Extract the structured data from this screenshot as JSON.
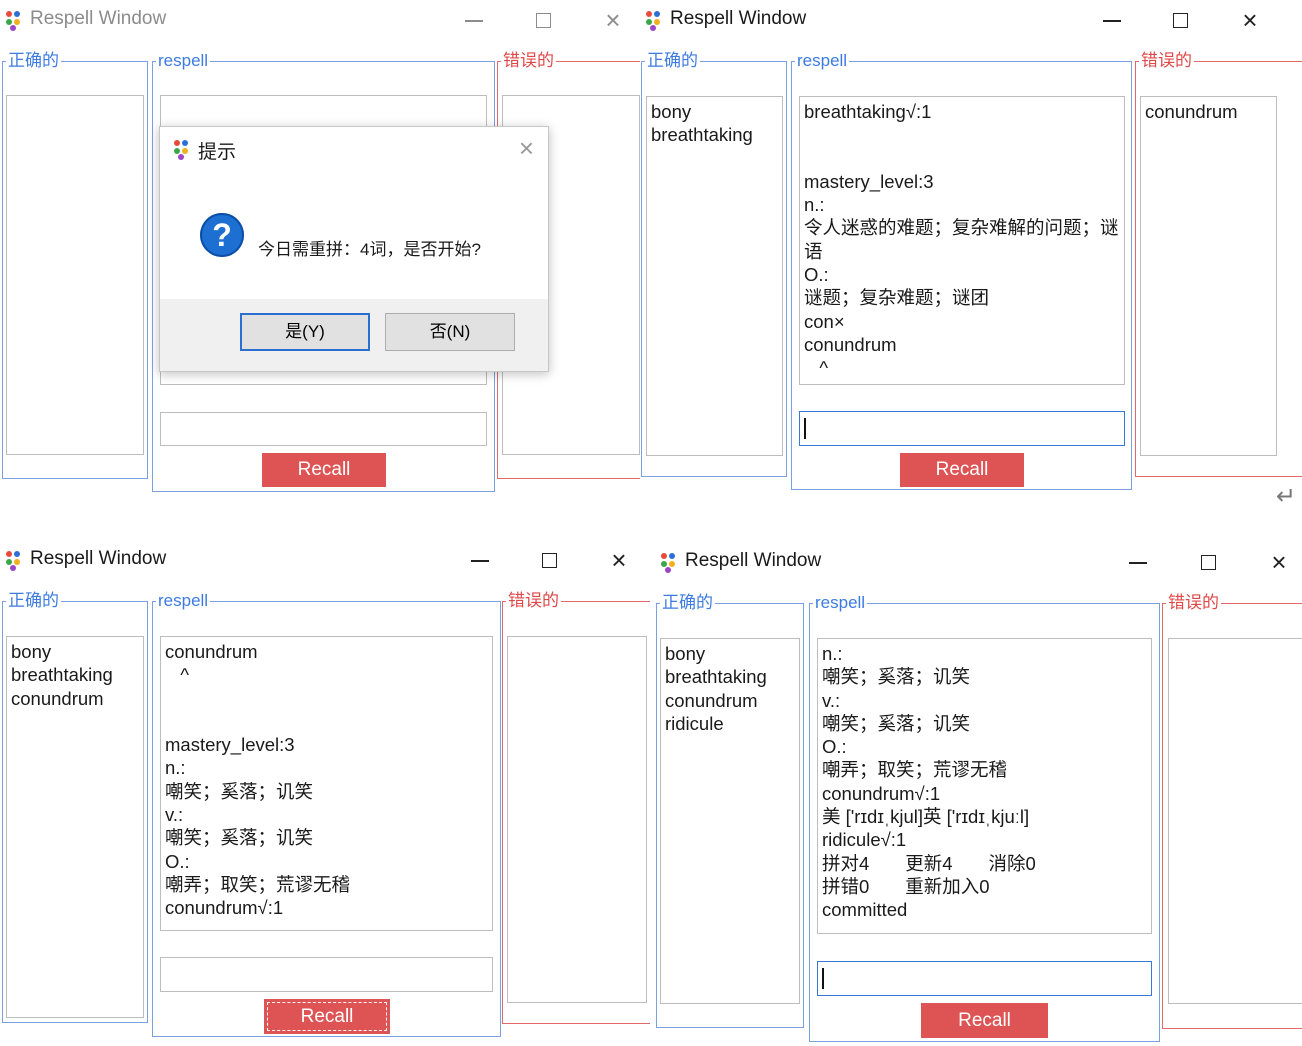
{
  "app_title": "Respell Window",
  "group_labels": {
    "correct": "正确的",
    "respell": "respell",
    "wrong": "错误的"
  },
  "recall_label": "Recall",
  "window_controls": {
    "minimize": "minimize-icon",
    "maximize": "maximize-icon",
    "close": "close-icon"
  },
  "windows": [
    {
      "id": "top-left",
      "active": false,
      "correct_list": "",
      "respell_text": "",
      "wrong_list": "",
      "dialog": {
        "title": "提示",
        "message": "今日需重拼：4词，是否开始?",
        "yes_label": "是(Y)",
        "no_label": "否(N)",
        "icon": "question-icon"
      }
    },
    {
      "id": "top-right",
      "active": true,
      "correct_list": "bony\nbreathtaking",
      "respell_text": "breathtaking√:1\n\n\nmastery_level:3\nn.:\n令人迷惑的难题；复杂难解的问题；谜\n语\nO.:\n谜题；复杂难题；谜团\ncon×\nconundrum\n   ^",
      "wrong_list": "conundrum"
    },
    {
      "id": "bottom-left",
      "active": true,
      "correct_list": "bony\nbreathtaking\nconundrum",
      "respell_text": "conundrum\n   ^\n\n\nmastery_level:3\nn.:\n嘲笑；奚落；讥笑\nv.:\n嘲笑；奚落；讥笑\nO.:\n嘲弄；取笑；荒谬无稽\nconundrum√:1",
      "wrong_list": ""
    },
    {
      "id": "bottom-right",
      "active": true,
      "correct_list": "bony\nbreathtaking\nconundrum\nridicule",
      "respell_text": "n.:\n嘲笑；奚落；讥笑\nv.:\n嘲笑；奚落；讥笑\nO.:\n嘲弄；取笑；荒谬无稽\nconundrum√:1\n美 ['rɪdɪˌkjul]英 ['rɪdɪˌkjuːl]\nridicule√:1\n拼对4       更新4       消除0\n拼错0       重新加入0\ncommitted",
      "wrong_list": ""
    }
  ],
  "misc": {
    "enter_glyph": "↵"
  }
}
